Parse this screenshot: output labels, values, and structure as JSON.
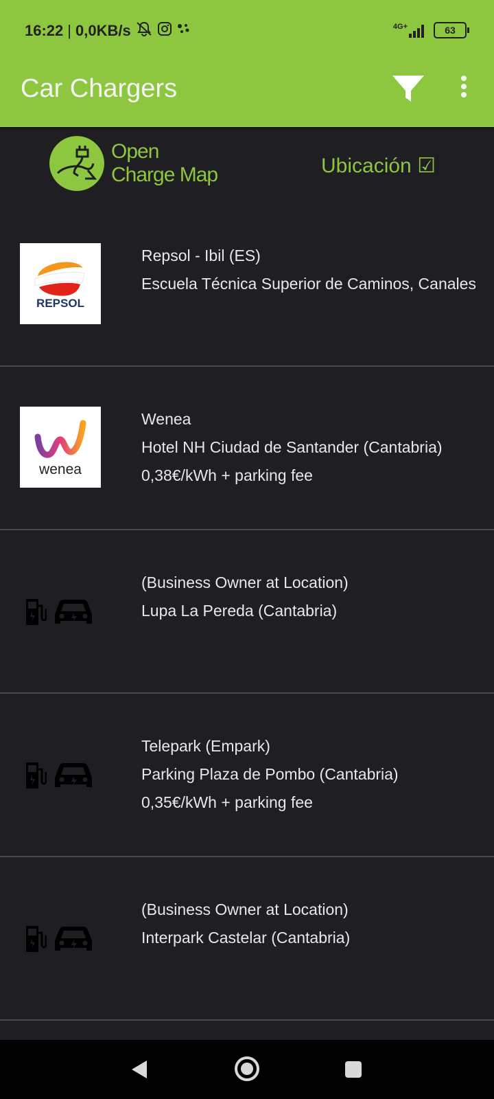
{
  "status_bar": {
    "time": "16:22",
    "separator": "|",
    "speed": "0,0KB/s",
    "network": "4G+",
    "battery": "63",
    "icons": [
      "mute-notifications-icon",
      "instagram-icon",
      "assistant-dots-icon",
      "signal-icon",
      "battery-icon"
    ]
  },
  "appbar": {
    "title": "Car Chargers",
    "filter_icon": "filter-icon",
    "menu_icon": "more-vert-icon"
  },
  "header": {
    "brand_line1": "Open",
    "brand_line2": "Charge Map",
    "location_label": "Ubicación ☑"
  },
  "colors": {
    "accent": "#8dc63f",
    "background": "#1f1e23",
    "divider": "#4a4a4f"
  },
  "chargers": [
    {
      "logo": "repsol",
      "logo_text": "REPSOL",
      "line1": "Repsol - Ibil (ES)",
      "line2": "Escuela Técnica Superior de Caminos, Canales",
      "line3": ""
    },
    {
      "logo": "wenea",
      "logo_text": "wenea",
      "line1": "Wenea",
      "line2": "Hotel NH  Ciudad de Santander (Cantabria)",
      "line3": "0,38€/kWh + parking fee"
    },
    {
      "logo": "generic",
      "line1": "(Business Owner at Location)",
      "line2": "Lupa La Pereda (Cantabria)",
      "line3": ""
    },
    {
      "logo": "generic",
      "line1": "Telepark (Empark)",
      "line2": "Parking Plaza de Pombo (Cantabria)",
      "line3": "0,35€/kWh + parking fee"
    },
    {
      "logo": "generic",
      "line1": "(Business Owner at Location)",
      "line2": "Interpark Castelar (Cantabria)",
      "line3": ""
    }
  ],
  "navbar": {
    "back_icon": "back-triangle-icon",
    "home_icon": "home-circle-icon",
    "recents_icon": "recents-square-icon"
  }
}
